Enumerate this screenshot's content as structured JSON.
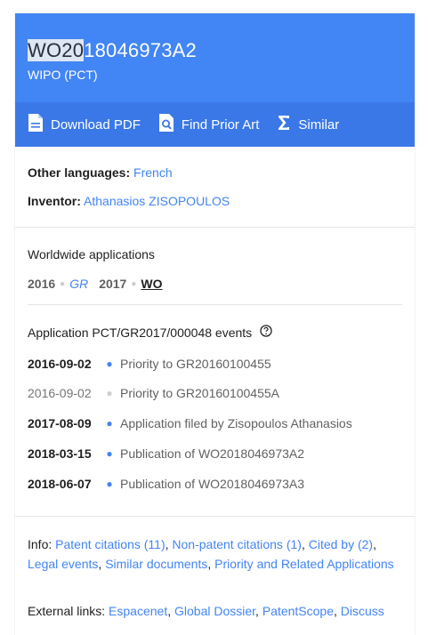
{
  "header": {
    "pub_highlight": "WO20",
    "pub_rest": "18046973A2",
    "office": "WIPO (PCT)"
  },
  "toolbar": {
    "download": "Download PDF",
    "prior_art": "Find Prior Art",
    "similar": "Similar"
  },
  "meta": {
    "other_languages_label": "Other languages:",
    "other_languages_value": "French",
    "inventor_label": "Inventor:",
    "inventor_value": "Athanasios ZISOPOULOS"
  },
  "worldwide": {
    "title": "Worldwide applications",
    "entries": [
      {
        "year": "2016",
        "country": "GR"
      },
      {
        "year": "2017",
        "country": "WO"
      }
    ]
  },
  "events": {
    "title": "Application PCT/GR2017/000048 events",
    "items": [
      {
        "date": "2016-09-02",
        "text": "Priority to GR20160100455"
      },
      {
        "date": "2016-09-02",
        "text": "Priority to GR20160100455A"
      },
      {
        "date": "2017-08-09",
        "text": "Application filed by Zisopoulos Athanasios"
      },
      {
        "date": "2018-03-15",
        "text": "Publication of WO2018046973A2"
      },
      {
        "date": "2018-06-07",
        "text": "Publication of WO2018046973A3"
      }
    ]
  },
  "info": {
    "label": "Info:",
    "links": [
      "Patent citations (11)",
      "Non-patent citations (1)",
      "Cited by (2)",
      "Legal events",
      "Similar documents",
      "Priority and Related Applications"
    ]
  },
  "external": {
    "label": "External links:",
    "links": [
      "Espacenet",
      "Global Dossier",
      "PatentScope",
      "Discuss"
    ]
  },
  "colors": {
    "header": "#4285f4",
    "toolbar": "#3b78e7",
    "link": "#4285f4"
  },
  "icons": [
    "pdf-icon",
    "search-doc-icon",
    "sigma-icon",
    "help-circle-icon"
  ]
}
